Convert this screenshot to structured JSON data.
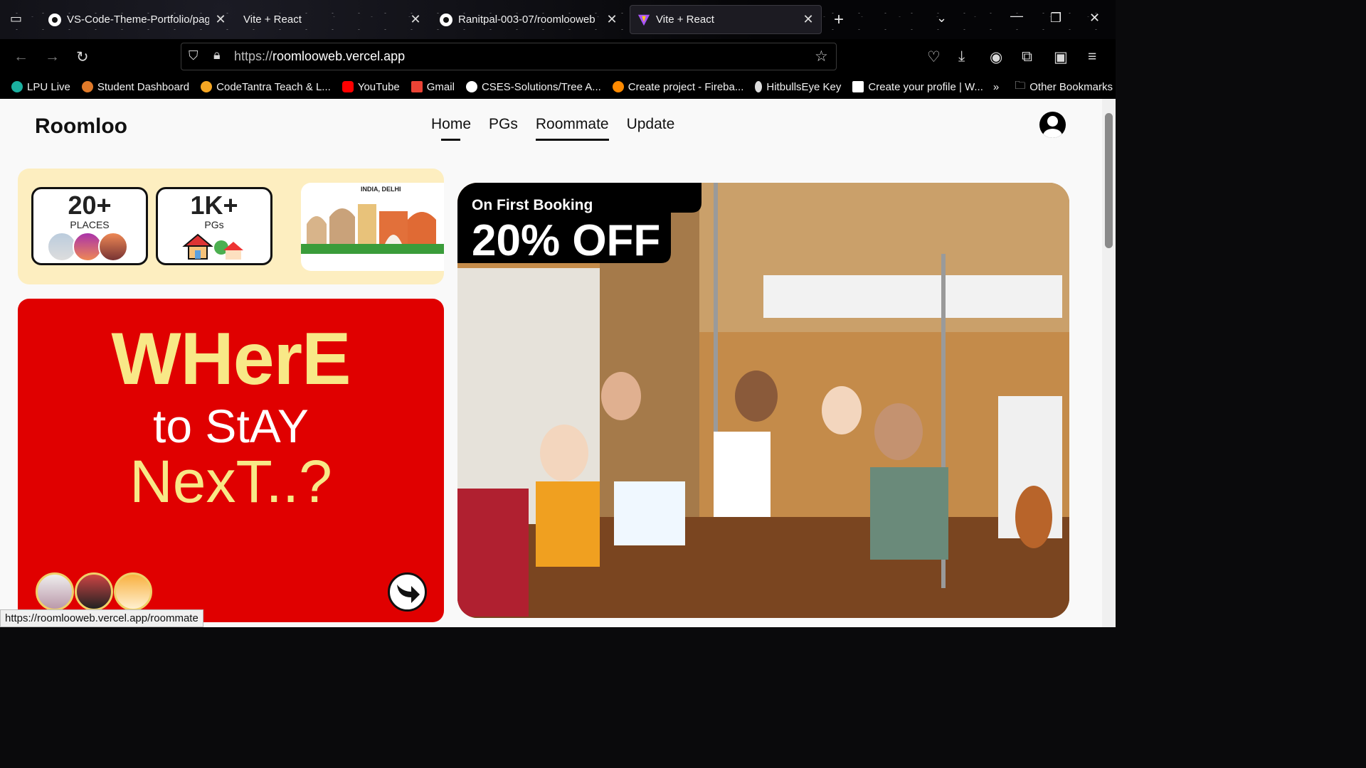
{
  "browser": {
    "tabs": [
      {
        "title": "VS-Code-Theme-Portfolio/page",
        "icon": "github-icon"
      },
      {
        "title": "Vite + React",
        "icon": "none"
      },
      {
        "title": "Ranitpal-003-07/roomlooweb",
        "icon": "github-icon"
      },
      {
        "title": "Vite + React",
        "icon": "vite-icon",
        "active": true
      }
    ],
    "url_prefix": "https://",
    "url_host": "roomlooweb.vercel.app",
    "bookmarks": [
      {
        "label": "LPU Live",
        "color": "#1bb0a0"
      },
      {
        "label": "Student Dashboard",
        "color": "#e07a2a"
      },
      {
        "label": "CodeTantra Teach & L...",
        "color": "#f5a623"
      },
      {
        "label": "YouTube",
        "color": "#ff0000"
      },
      {
        "label": "Gmail",
        "color": "#ea4335"
      },
      {
        "label": "CSES-Solutions/Tree A...",
        "color": "#ffffff"
      },
      {
        "label": "Create project - Fireba...",
        "color": "#ff8a00"
      },
      {
        "label": "HitbullsEye Key",
        "color": "#dddddd"
      },
      {
        "label": "Create your profile | W...",
        "color": "#ffffff"
      }
    ],
    "other_bookmarks": "Other Bookmarks",
    "status_url": "https://roomlooweb.vercel.app/roommate"
  },
  "site": {
    "brand": "Roomloo",
    "nav": [
      "Home",
      "PGs",
      "Roommate",
      "Update"
    ],
    "stats": [
      {
        "value": "20+",
        "label": "PLACES"
      },
      {
        "value": "1K+",
        "label": "PGs"
      }
    ],
    "city_tag": "INDIA, DELHI",
    "hero_lines": [
      "WHerE",
      "to StAY",
      "NexT..?"
    ],
    "promo_small": "On First Booking",
    "promo_big": "20% OFF"
  }
}
